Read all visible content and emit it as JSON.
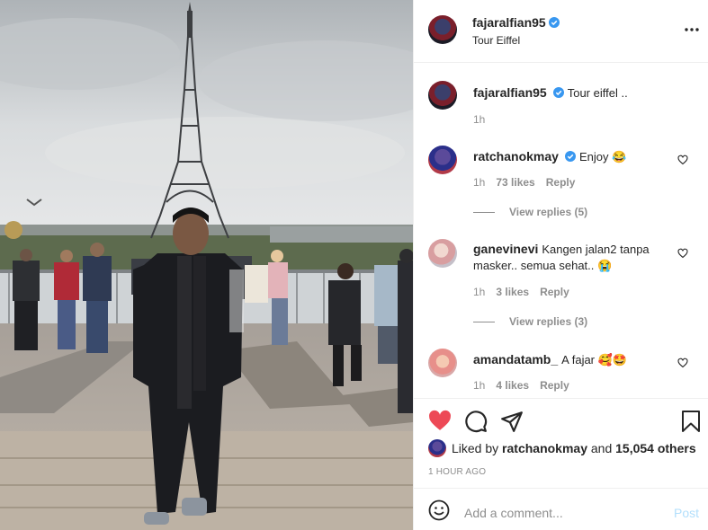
{
  "post": {
    "author": "fajaralfian95",
    "location": "Tour Eiffel",
    "more_icon": "more-horizontal-icon"
  },
  "caption": {
    "author": "fajaralfian95",
    "text": "Tour eiffel ..",
    "time": "1h"
  },
  "comments": [
    {
      "user": "ratchanokmay",
      "verified": true,
      "text": "Enjoy 😂",
      "time": "1h",
      "likes": "73 likes",
      "reply": "Reply",
      "view_replies": "View replies (5)"
    },
    {
      "user": "ganevinevi",
      "verified": false,
      "text": "Kangen jalan2 tanpa masker.. semua sehat.. 😭",
      "time": "1h",
      "likes": "3 likes",
      "reply": "Reply",
      "view_replies": "View replies (3)"
    },
    {
      "user": "amandatamb_",
      "verified": false,
      "text": "A fajar 🥰🤩",
      "time": "1h",
      "likes": "4 likes",
      "reply": "Reply"
    }
  ],
  "actions": {
    "liked_by_prefix": "Liked by",
    "liked_by_user": "ratchanokmay",
    "liked_by_and": "and",
    "liked_by_others": "15,054 others",
    "timestamp": "1 HOUR AGO"
  },
  "add_comment": {
    "placeholder": "Add a comment...",
    "post_label": "Post"
  },
  "colors": {
    "like_red": "#ed4956",
    "verified_blue": "#3897f0",
    "post_disabled": "#b2dffc"
  }
}
